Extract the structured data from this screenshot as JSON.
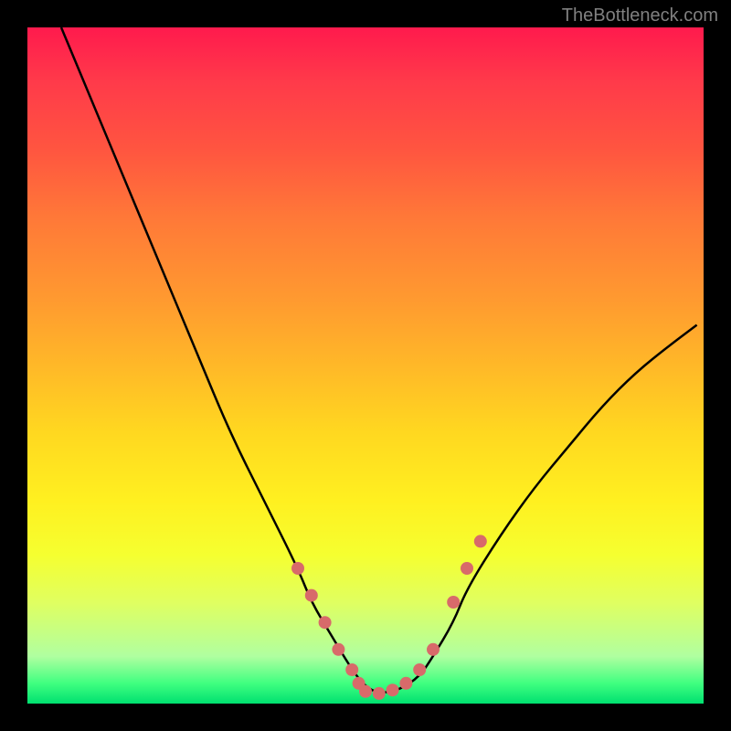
{
  "watermark": "TheBottleneck.com",
  "chart_data": {
    "type": "line",
    "title": "",
    "xlabel": "",
    "ylabel": "",
    "xlim": [
      0,
      100
    ],
    "ylim": [
      0,
      100
    ],
    "series": [
      {
        "name": "curve",
        "x": [
          5,
          10,
          15,
          20,
          25,
          30,
          35,
          40,
          42,
          45,
          48,
          50,
          52,
          55,
          58,
          60,
          63,
          65,
          70,
          75,
          80,
          85,
          90,
          95,
          99
        ],
        "y": [
          100,
          88,
          76,
          64,
          52,
          40,
          30,
          20,
          15,
          10,
          5,
          2.5,
          1.5,
          2,
          4,
          7,
          12,
          17,
          25,
          32,
          38,
          44,
          49,
          53,
          56
        ]
      }
    ],
    "markers": [
      {
        "x": 40,
        "y": 20
      },
      {
        "x": 42,
        "y": 16
      },
      {
        "x": 44,
        "y": 12
      },
      {
        "x": 46,
        "y": 8
      },
      {
        "x": 48,
        "y": 5
      },
      {
        "x": 49,
        "y": 3
      },
      {
        "x": 50,
        "y": 1.8
      },
      {
        "x": 52,
        "y": 1.5
      },
      {
        "x": 54,
        "y": 2
      },
      {
        "x": 56,
        "y": 3
      },
      {
        "x": 58,
        "y": 5
      },
      {
        "x": 60,
        "y": 8
      },
      {
        "x": 63,
        "y": 15
      },
      {
        "x": 65,
        "y": 20
      },
      {
        "x": 67,
        "y": 24
      }
    ]
  }
}
